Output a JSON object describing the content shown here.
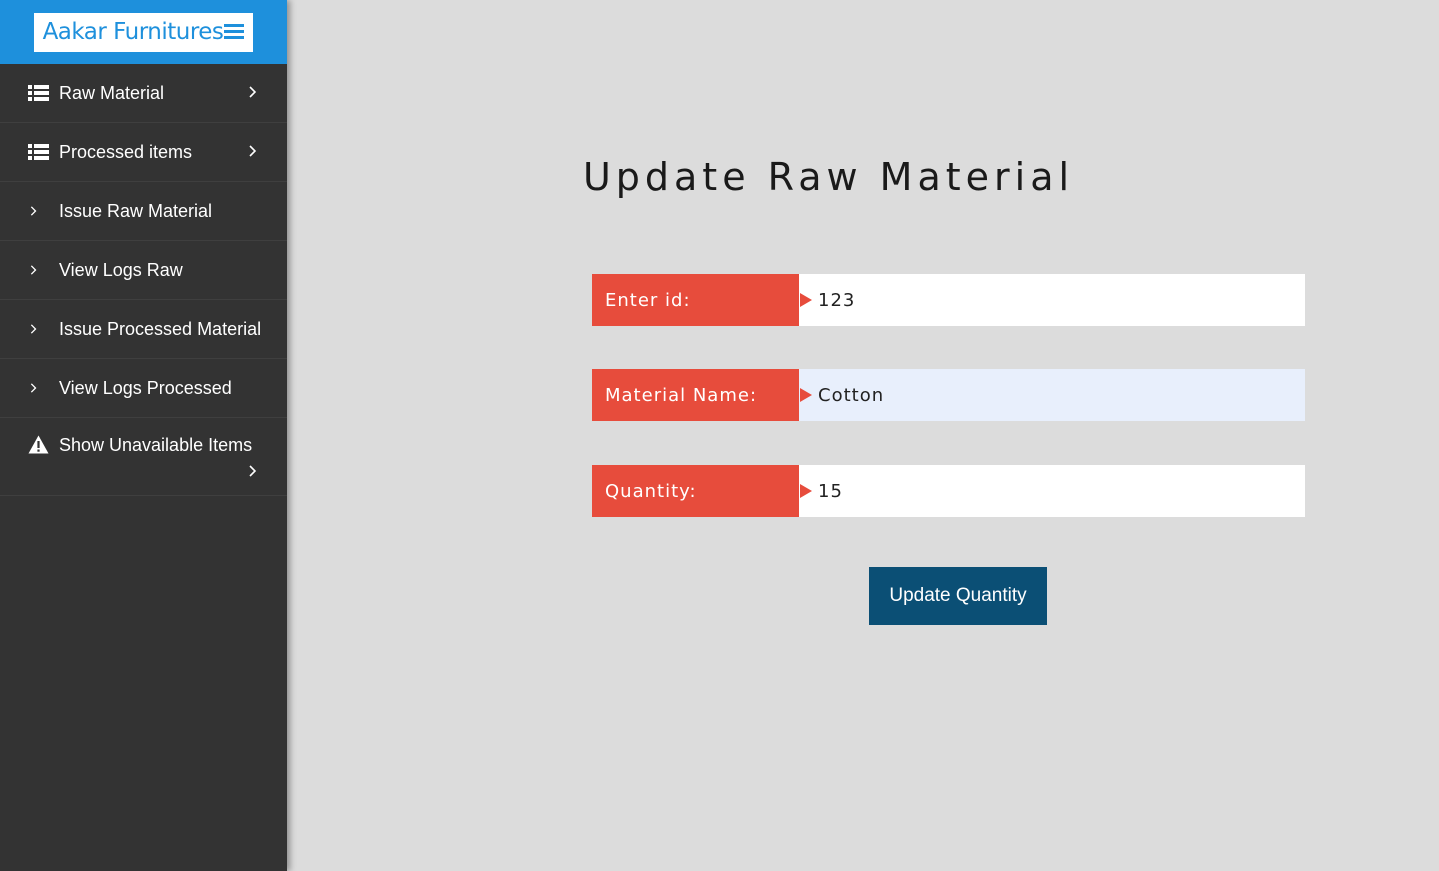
{
  "brand": {
    "title": "Aakar Furnitures",
    "icon": "hamburger-icon",
    "color": "#1e90dc"
  },
  "sidebar": {
    "items": [
      {
        "label": "Raw Material",
        "icon": "list-icon",
        "has_submenu": true
      },
      {
        "label": "Processed items",
        "icon": "list-icon",
        "has_submenu": true
      },
      {
        "label": "Issue Raw Material",
        "icon": "chevron-right-icon",
        "has_submenu": false
      },
      {
        "label": "View Logs Raw",
        "icon": "chevron-right-icon",
        "has_submenu": false
      },
      {
        "label": "Issue Processed Material",
        "icon": "chevron-right-icon",
        "has_submenu": false
      },
      {
        "label": "View Logs Processed",
        "icon": "chevron-right-icon",
        "has_submenu": false
      },
      {
        "label": "Show Unavailable Items",
        "icon": "warning-icon",
        "has_submenu": true
      }
    ]
  },
  "main": {
    "title": "Update Raw Material",
    "form": {
      "id_label": "Enter id:",
      "id_value": "123",
      "name_label": "Material Name:",
      "name_value": "Cotton",
      "quantity_label": "Quantity:",
      "quantity_value": "15"
    },
    "submit_label": "Update Quantity"
  },
  "colors": {
    "label_bg": "#e74c3c",
    "button_bg": "#0b4f75",
    "sidebar_bg": "#333333",
    "page_bg": "#dcdcdc"
  }
}
